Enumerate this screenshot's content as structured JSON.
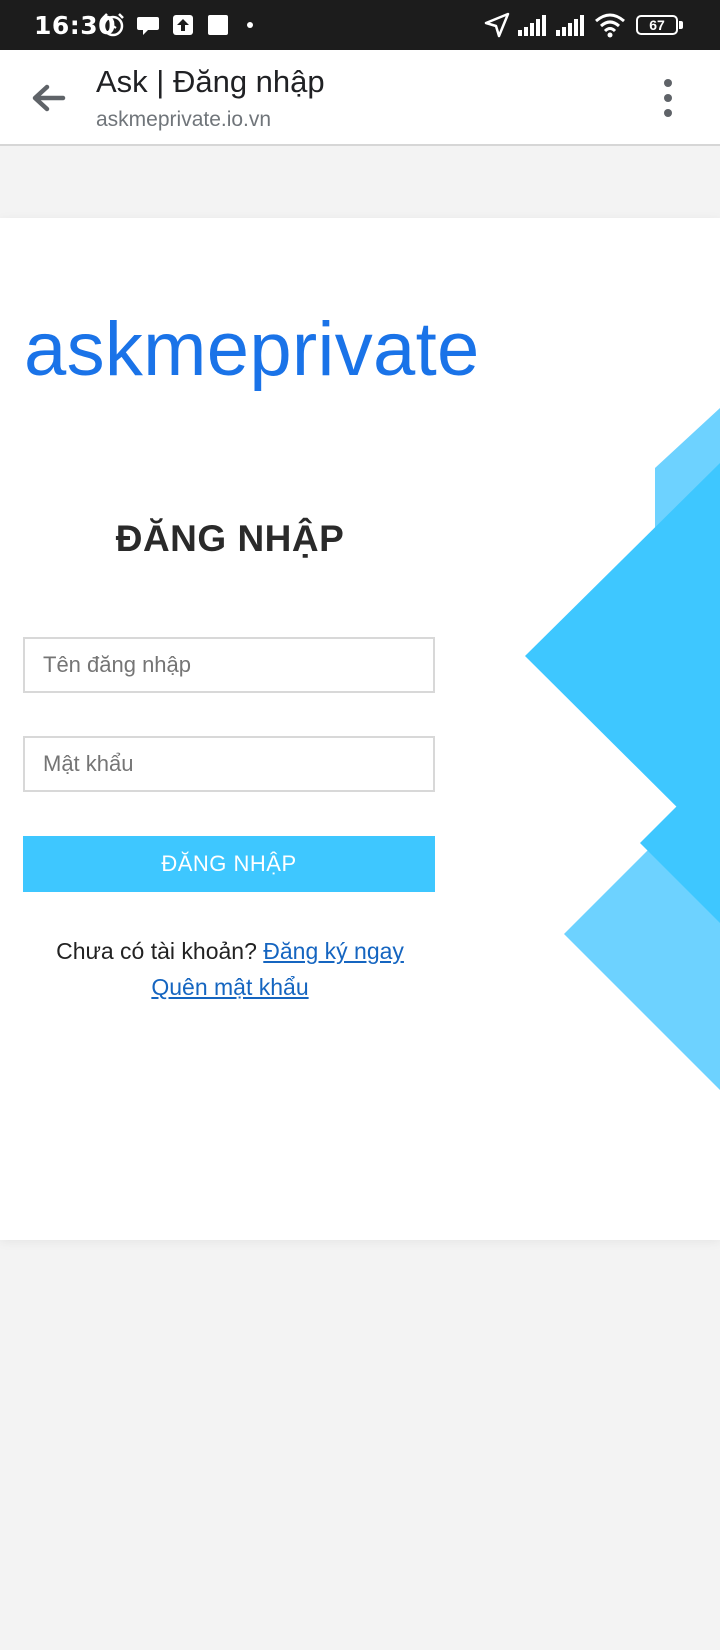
{
  "status_bar": {
    "time": "16:30",
    "battery": "67",
    "icons": [
      "alarm-icon",
      "chat-bubble-icon",
      "upload-icon",
      "square-icon",
      "dot-icon",
      "location-arrow-icon",
      "signal-icon",
      "signal-icon",
      "wifi-icon",
      "battery-icon"
    ]
  },
  "browser": {
    "title": "Ask | Đăng nhập",
    "url": "askmeprivate.io.vn",
    "back_icon": "arrow-left-icon",
    "menu_icon": "more-vert-icon"
  },
  "page": {
    "brand": "askmeprivate",
    "heading": "ĐĂNG NHẬP",
    "username_placeholder": "Tên đăng nhập",
    "password_placeholder": "Mật khẩu",
    "submit_label": "ĐĂNG NHẬP",
    "signup_prompt": "Chưa có tài khoản?",
    "signup_link": "Đăng ký ngay",
    "forgot_link": "Quên mật khẩu"
  },
  "colors": {
    "brand": "#1a73e8",
    "button": "#3ec7ff",
    "link": "#1565c0",
    "decor_primary": "#3ec7ff",
    "decor_light": "#6dd2ff"
  }
}
